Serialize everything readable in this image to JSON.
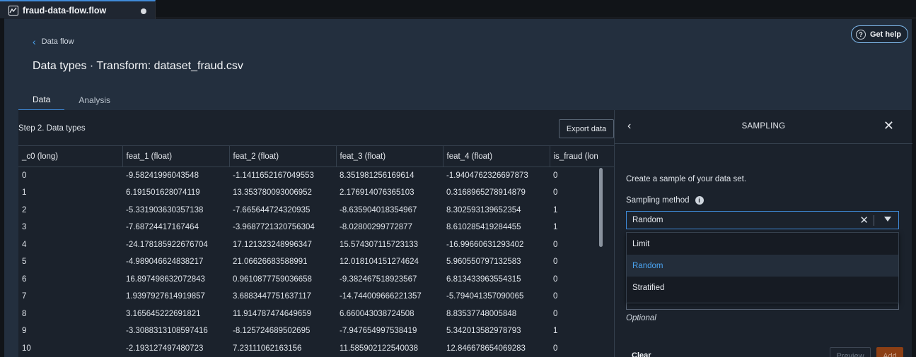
{
  "file_tab": {
    "name": "fraud-data-flow.flow"
  },
  "header": {
    "breadcrumb": "Data flow",
    "title": "Data types · Transform: dataset_fraud.csv",
    "get_help": "Get help"
  },
  "tabs": [
    {
      "label": "Data",
      "active": true
    },
    {
      "label": "Analysis",
      "active": false
    }
  ],
  "data_panel": {
    "step_label": "Step 2. Data types",
    "export_label": "Export data",
    "columns": [
      "_c0 (long)",
      "feat_1 (float)",
      "feat_2 (float)",
      "feat_3 (float)",
      "feat_4 (float)",
      "is_fraud (lon"
    ],
    "rows": [
      [
        "0",
        "-9.58241996043548",
        "-1.1411652167049553",
        "8.351981256169614",
        "-1.9404762326697873",
        "0"
      ],
      [
        "1",
        "6.191501628074119",
        "13.353780093006952",
        "2.176914076365103",
        "0.3168965278914879",
        "0"
      ],
      [
        "2",
        "-5.331903630357138",
        "-7.665644724320935",
        "-8.635904018354967",
        "8.302593139652354",
        "1"
      ],
      [
        "3",
        "-7.68724417167464",
        "-3.9687721320756304",
        "-8.02800299772877",
        "8.610285419284455",
        "1"
      ],
      [
        "4",
        "-24.178185922676704",
        "17.121323248996347",
        "15.574307115723133",
        "-16.99660631293402",
        "0"
      ],
      [
        "5",
        "-4.989046624838217",
        "21.06626683588991",
        "12.018104151274624",
        "5.960550797132583",
        "0"
      ],
      [
        "6",
        "16.897498632072843",
        "0.9610877759036658",
        "-9.382467518923567",
        "6.813433963554315",
        "0"
      ],
      [
        "7",
        "1.9397927614919857",
        "3.6883447751637117",
        "-14.744009666221357",
        "-5.794041357090065",
        "0"
      ],
      [
        "8",
        "3.165645222691821",
        "11.914787474649659",
        "6.660043038724508",
        "8.83537748005848",
        "0"
      ],
      [
        "9",
        "-3.3088313108597416",
        "-8.125724689502695",
        "-7.947654997538419",
        "5.342013582978793",
        "1"
      ],
      [
        "10",
        "-2.193127497480723",
        "7.23111062163156",
        "11.585902122540038",
        "12.846678654069283",
        "0"
      ]
    ]
  },
  "sampling": {
    "title": "SAMPLING",
    "description": "Create a sample of your data set.",
    "method_label": "Sampling method",
    "selected_method": "Random",
    "options": [
      "Limit",
      "Random",
      "Stratified"
    ],
    "optional_label": "Optional",
    "clear_label": "Clear",
    "preview_label": "Preview",
    "add_label": "Add"
  },
  "colors": {
    "accent": "#3f8ad8",
    "add_button": "#8c3f14",
    "background": "#232f3e"
  }
}
